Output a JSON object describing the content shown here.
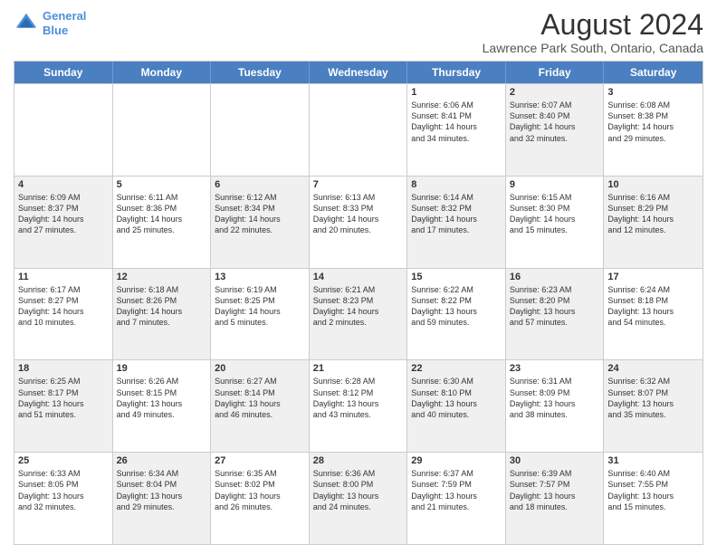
{
  "header": {
    "logo_line1": "General",
    "logo_line2": "Blue",
    "month": "August 2024",
    "location": "Lawrence Park South, Ontario, Canada"
  },
  "weekdays": [
    "Sunday",
    "Monday",
    "Tuesday",
    "Wednesday",
    "Thursday",
    "Friday",
    "Saturday"
  ],
  "rows": [
    [
      {
        "day": "",
        "info": "",
        "shaded": false
      },
      {
        "day": "",
        "info": "",
        "shaded": false
      },
      {
        "day": "",
        "info": "",
        "shaded": false
      },
      {
        "day": "",
        "info": "",
        "shaded": false
      },
      {
        "day": "1",
        "info": "Sunrise: 6:06 AM\nSunset: 8:41 PM\nDaylight: 14 hours\nand 34 minutes.",
        "shaded": false
      },
      {
        "day": "2",
        "info": "Sunrise: 6:07 AM\nSunset: 8:40 PM\nDaylight: 14 hours\nand 32 minutes.",
        "shaded": true
      },
      {
        "day": "3",
        "info": "Sunrise: 6:08 AM\nSunset: 8:38 PM\nDaylight: 14 hours\nand 29 minutes.",
        "shaded": false
      }
    ],
    [
      {
        "day": "4",
        "info": "Sunrise: 6:09 AM\nSunset: 8:37 PM\nDaylight: 14 hours\nand 27 minutes.",
        "shaded": true
      },
      {
        "day": "5",
        "info": "Sunrise: 6:11 AM\nSunset: 8:36 PM\nDaylight: 14 hours\nand 25 minutes.",
        "shaded": false
      },
      {
        "day": "6",
        "info": "Sunrise: 6:12 AM\nSunset: 8:34 PM\nDaylight: 14 hours\nand 22 minutes.",
        "shaded": true
      },
      {
        "day": "7",
        "info": "Sunrise: 6:13 AM\nSunset: 8:33 PM\nDaylight: 14 hours\nand 20 minutes.",
        "shaded": false
      },
      {
        "day": "8",
        "info": "Sunrise: 6:14 AM\nSunset: 8:32 PM\nDaylight: 14 hours\nand 17 minutes.",
        "shaded": true
      },
      {
        "day": "9",
        "info": "Sunrise: 6:15 AM\nSunset: 8:30 PM\nDaylight: 14 hours\nand 15 minutes.",
        "shaded": false
      },
      {
        "day": "10",
        "info": "Sunrise: 6:16 AM\nSunset: 8:29 PM\nDaylight: 14 hours\nand 12 minutes.",
        "shaded": true
      }
    ],
    [
      {
        "day": "11",
        "info": "Sunrise: 6:17 AM\nSunset: 8:27 PM\nDaylight: 14 hours\nand 10 minutes.",
        "shaded": false
      },
      {
        "day": "12",
        "info": "Sunrise: 6:18 AM\nSunset: 8:26 PM\nDaylight: 14 hours\nand 7 minutes.",
        "shaded": true
      },
      {
        "day": "13",
        "info": "Sunrise: 6:19 AM\nSunset: 8:25 PM\nDaylight: 14 hours\nand 5 minutes.",
        "shaded": false
      },
      {
        "day": "14",
        "info": "Sunrise: 6:21 AM\nSunset: 8:23 PM\nDaylight: 14 hours\nand 2 minutes.",
        "shaded": true
      },
      {
        "day": "15",
        "info": "Sunrise: 6:22 AM\nSunset: 8:22 PM\nDaylight: 13 hours\nand 59 minutes.",
        "shaded": false
      },
      {
        "day": "16",
        "info": "Sunrise: 6:23 AM\nSunset: 8:20 PM\nDaylight: 13 hours\nand 57 minutes.",
        "shaded": true
      },
      {
        "day": "17",
        "info": "Sunrise: 6:24 AM\nSunset: 8:18 PM\nDaylight: 13 hours\nand 54 minutes.",
        "shaded": false
      }
    ],
    [
      {
        "day": "18",
        "info": "Sunrise: 6:25 AM\nSunset: 8:17 PM\nDaylight: 13 hours\nand 51 minutes.",
        "shaded": true
      },
      {
        "day": "19",
        "info": "Sunrise: 6:26 AM\nSunset: 8:15 PM\nDaylight: 13 hours\nand 49 minutes.",
        "shaded": false
      },
      {
        "day": "20",
        "info": "Sunrise: 6:27 AM\nSunset: 8:14 PM\nDaylight: 13 hours\nand 46 minutes.",
        "shaded": true
      },
      {
        "day": "21",
        "info": "Sunrise: 6:28 AM\nSunset: 8:12 PM\nDaylight: 13 hours\nand 43 minutes.",
        "shaded": false
      },
      {
        "day": "22",
        "info": "Sunrise: 6:30 AM\nSunset: 8:10 PM\nDaylight: 13 hours\nand 40 minutes.",
        "shaded": true
      },
      {
        "day": "23",
        "info": "Sunrise: 6:31 AM\nSunset: 8:09 PM\nDaylight: 13 hours\nand 38 minutes.",
        "shaded": false
      },
      {
        "day": "24",
        "info": "Sunrise: 6:32 AM\nSunset: 8:07 PM\nDaylight: 13 hours\nand 35 minutes.",
        "shaded": true
      }
    ],
    [
      {
        "day": "25",
        "info": "Sunrise: 6:33 AM\nSunset: 8:05 PM\nDaylight: 13 hours\nand 32 minutes.",
        "shaded": false
      },
      {
        "day": "26",
        "info": "Sunrise: 6:34 AM\nSunset: 8:04 PM\nDaylight: 13 hours\nand 29 minutes.",
        "shaded": true
      },
      {
        "day": "27",
        "info": "Sunrise: 6:35 AM\nSunset: 8:02 PM\nDaylight: 13 hours\nand 26 minutes.",
        "shaded": false
      },
      {
        "day": "28",
        "info": "Sunrise: 6:36 AM\nSunset: 8:00 PM\nDaylight: 13 hours\nand 24 minutes.",
        "shaded": true
      },
      {
        "day": "29",
        "info": "Sunrise: 6:37 AM\nSunset: 7:59 PM\nDaylight: 13 hours\nand 21 minutes.",
        "shaded": false
      },
      {
        "day": "30",
        "info": "Sunrise: 6:39 AM\nSunset: 7:57 PM\nDaylight: 13 hours\nand 18 minutes.",
        "shaded": true
      },
      {
        "day": "31",
        "info": "Sunrise: 6:40 AM\nSunset: 7:55 PM\nDaylight: 13 hours\nand 15 minutes.",
        "shaded": false
      }
    ]
  ]
}
